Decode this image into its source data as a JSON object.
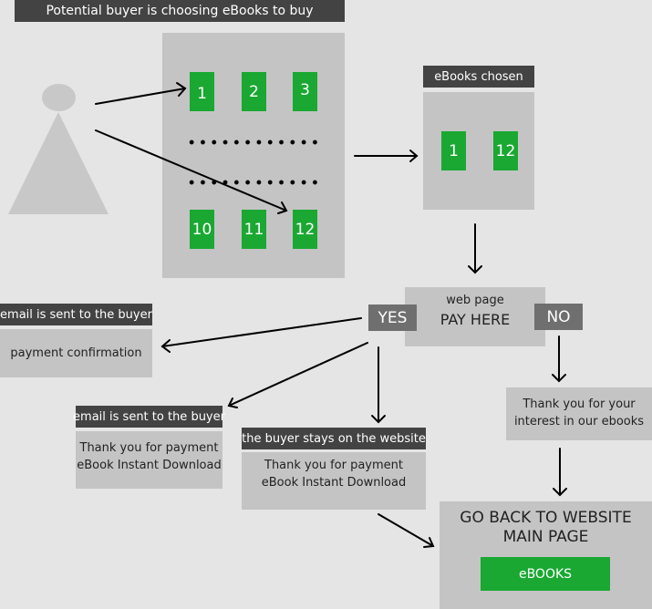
{
  "header": {
    "title": "Potential buyer is choosing eBooks to buy"
  },
  "catalog": {
    "top_row": [
      "1",
      "2",
      "3"
    ],
    "bottom_row": [
      "10",
      "11",
      "12"
    ]
  },
  "chosen": {
    "label": "eBooks chosen",
    "books": [
      "1",
      "12"
    ]
  },
  "payment": {
    "sub_label": "web page",
    "title": "PAY HERE",
    "yes_label": "YES",
    "no_label": "NO"
  },
  "email_confirmation": {
    "label": "email is sent to the buyer",
    "text": "payment confirmation"
  },
  "email_download": {
    "label": "email is sent to the buyer",
    "line1": "Thank you for payment",
    "line2": "eBook Instant Download"
  },
  "stays_on_site": {
    "label": "the buyer stays on the website",
    "line1": "Thank you for payment",
    "line2": "eBook Instant Download"
  },
  "no_result": {
    "line1": "Thank you for your",
    "line2": "interest in our ebooks"
  },
  "go_back": {
    "line1": "GO BACK TO WEBSITE",
    "line2": "MAIN PAGE",
    "button_label": "eBOOKS"
  },
  "colors": {
    "green": "#1aa832",
    "dark_label": "#434343",
    "panel": "#c4c4c4",
    "tag": "#6f6f6f",
    "background": "#e5e5e5"
  }
}
